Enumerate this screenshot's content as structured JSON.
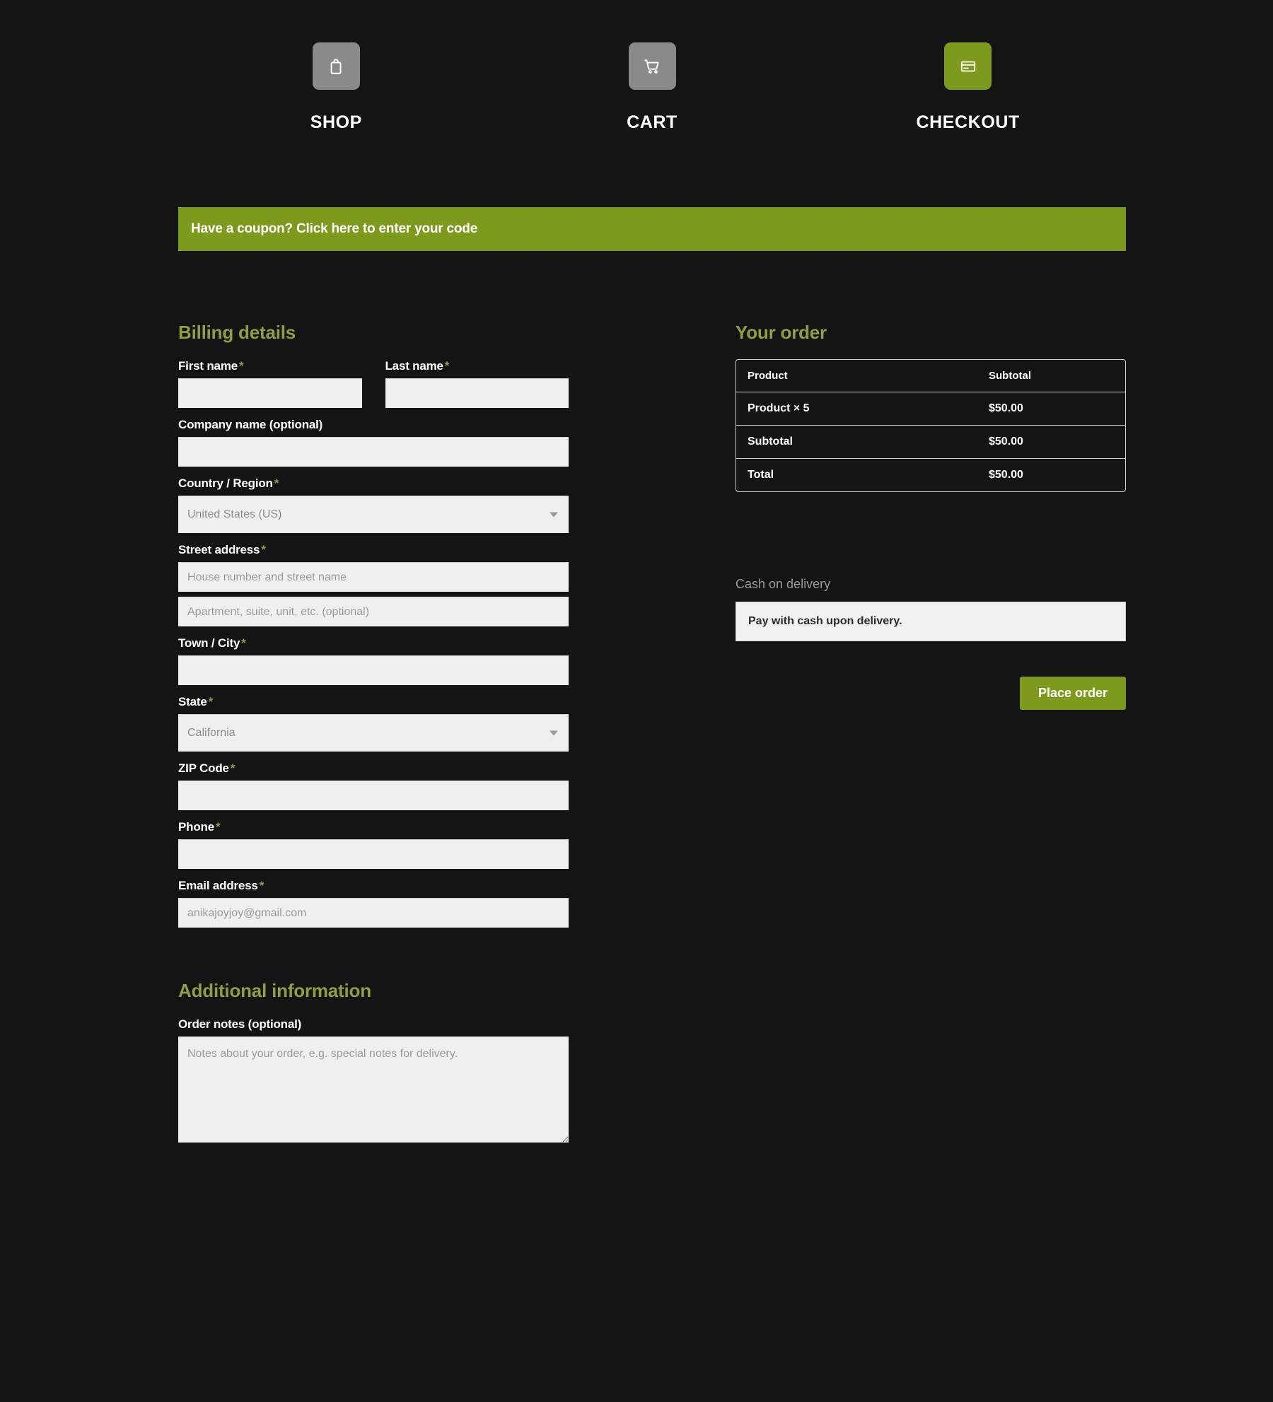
{
  "steps": [
    {
      "label": "SHOP",
      "icon": "shopping-bag-icon",
      "state": "inactive"
    },
    {
      "label": "CART",
      "icon": "shopping-cart-icon",
      "state": "inactive"
    },
    {
      "label": "CHECKOUT",
      "icon": "credit-card-icon",
      "state": "active"
    }
  ],
  "coupon": {
    "text": "Have a coupon? Click here to enter your code"
  },
  "billing": {
    "title": "Billing details",
    "first_name": {
      "label": "First name",
      "required": "*",
      "value": ""
    },
    "last_name": {
      "label": "Last name",
      "required": "*",
      "value": ""
    },
    "company": {
      "label": "Company name (optional)",
      "value": ""
    },
    "country": {
      "label": "Country / Region",
      "required": "*",
      "value": "United States (US)"
    },
    "street": {
      "label": "Street address",
      "required": "*",
      "line1_placeholder": "House number and street name",
      "line2_placeholder": "Apartment, suite, unit, etc. (optional)",
      "line1_value": "",
      "line2_value": ""
    },
    "city": {
      "label": "Town / City",
      "required": "*",
      "value": ""
    },
    "state": {
      "label": "State",
      "required": "*",
      "value": "California"
    },
    "zip": {
      "label": "ZIP Code",
      "required": "*",
      "value": ""
    },
    "phone": {
      "label": "Phone",
      "required": "*",
      "value": ""
    },
    "email": {
      "label": "Email address",
      "required": "*",
      "placeholder": "anikajoyjoy@gmail.com",
      "value": ""
    }
  },
  "order": {
    "title": "Your order",
    "columns": [
      "Product",
      "Subtotal"
    ],
    "rows": [
      {
        "name": "Product × 5",
        "amount": "$50.00"
      },
      {
        "name": "Subtotal",
        "amount": "$50.00"
      },
      {
        "name": "Total",
        "amount": "$50.00"
      }
    ]
  },
  "payment": {
    "method_label": "Cash on delivery",
    "description": "Pay with cash upon delivery.",
    "place_order_label": "Place order"
  },
  "additional": {
    "title": "Additional information",
    "notes_label": "Order notes (optional)",
    "notes_placeholder": "Notes about your order, e.g. special notes for delivery.",
    "notes_value": ""
  },
  "colors": {
    "accent_green": "#7d9a1c",
    "heading_green": "#8f9e3e",
    "background": "#141414",
    "input_background": "#efefef",
    "step_inactive": "#8a8a8a"
  }
}
